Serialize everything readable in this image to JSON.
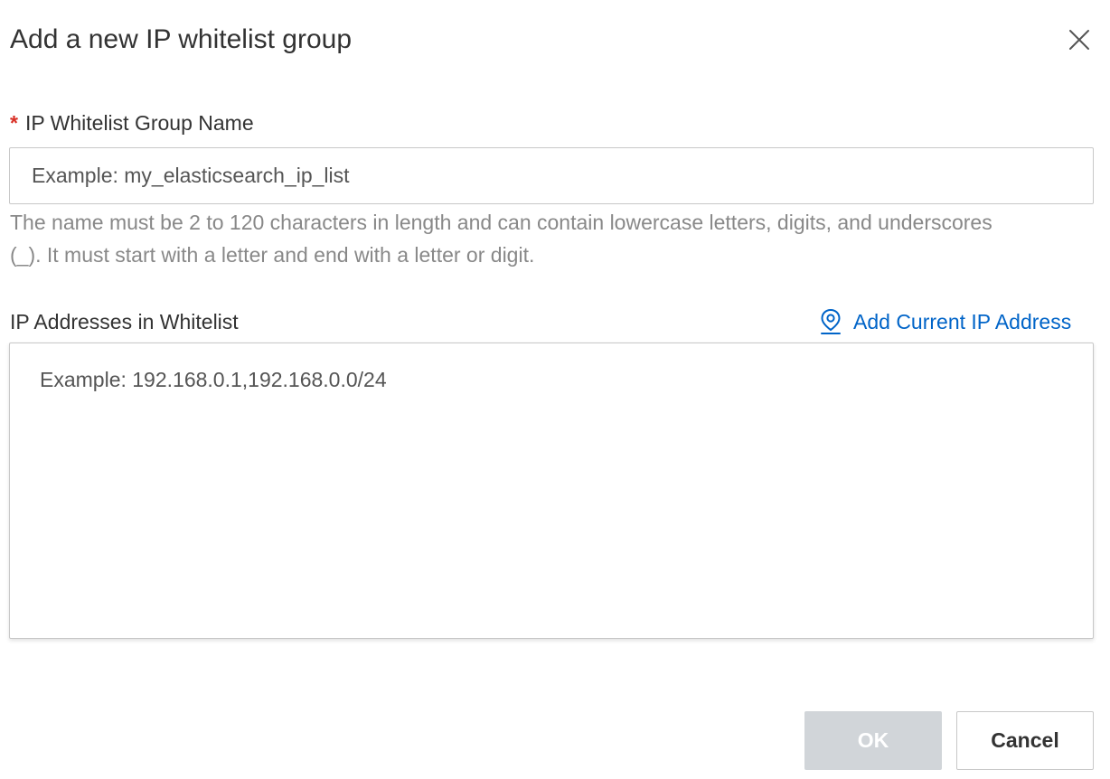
{
  "dialog": {
    "title": "Add a new IP whitelist group",
    "close_icon": "close-icon"
  },
  "group_name": {
    "required_mark": "*",
    "label": "IP Whitelist Group Name",
    "value": "",
    "placeholder": "Example: my_elasticsearch_ip_list",
    "help_text": "The name must be 2 to 120 characters in length and can contain lowercase letters, digits, and underscores (_). It must start with a letter and end with a letter or digit."
  },
  "ip_addresses": {
    "label": "IP Addresses in Whitelist",
    "add_current_ip_label": "Add Current IP Address",
    "add_current_ip_icon": "location-pin-icon",
    "value": "",
    "placeholder": "Example: 192.168.0.1,192.168.0.0/24"
  },
  "footer": {
    "ok_label": "OK",
    "ok_disabled": true,
    "cancel_label": "Cancel"
  },
  "colors": {
    "required": "#d93026",
    "link": "#0064c8",
    "help_text": "#888888",
    "ok_disabled_bg": "#d1d5d9"
  }
}
